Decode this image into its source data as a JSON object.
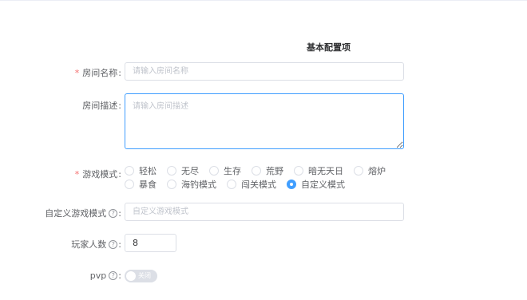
{
  "section_title": "基本配置项",
  "form": {
    "room_name": {
      "required_mark": "*",
      "label": "房间名称",
      "colon": ":",
      "placeholder": "请输入房间名称",
      "value": ""
    },
    "room_desc": {
      "label": "房间描述",
      "colon": ":",
      "placeholder": "请输入房间描述",
      "value": ""
    },
    "game_mode": {
      "required_mark": "*",
      "label": "游戏模式",
      "colon": ":",
      "options": [
        "轻松",
        "无尽",
        "生存",
        "荒野",
        "暗无天日",
        "熔炉",
        "暴食",
        "海钓模式",
        "闯关模式",
        "自定义模式"
      ],
      "selected": "自定义模式"
    },
    "custom_mode": {
      "label": "自定义游戏模式",
      "help_icon": "question-circle-icon",
      "colon": ":",
      "placeholder": "自定义游戏模式",
      "value": ""
    },
    "player_count": {
      "label": "玩家人数",
      "help_icon": "question-circle-icon",
      "colon": ":",
      "value": "8"
    },
    "pvp": {
      "label": "pvp",
      "help_icon": "question-circle-icon",
      "colon": ":",
      "switch_text": "关闭",
      "on": false
    }
  },
  "colors": {
    "accent": "#409eff",
    "required": "#f56c6c",
    "switch_off": "#dcdfe6"
  }
}
